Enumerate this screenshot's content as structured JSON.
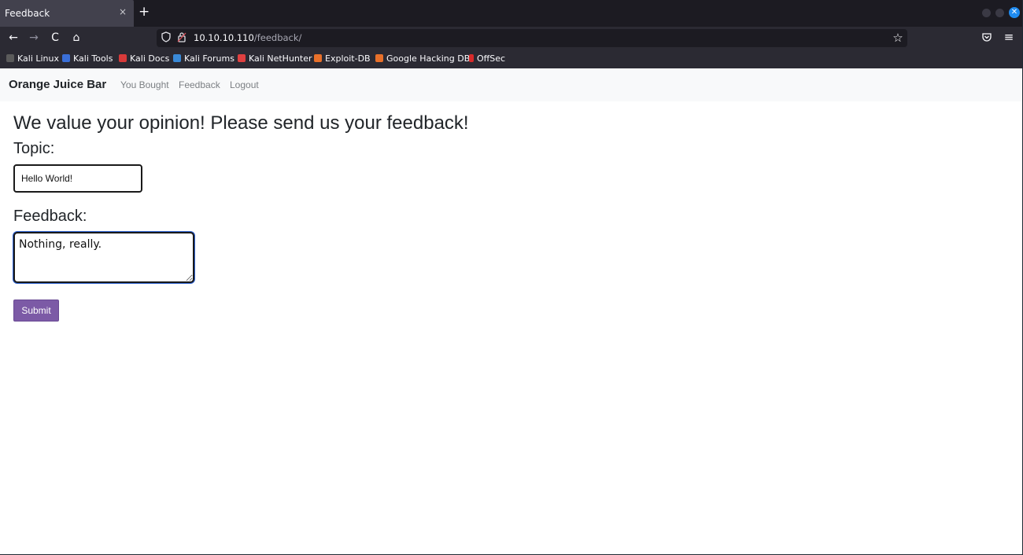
{
  "browser": {
    "tab": {
      "title": "Feedback",
      "close": "×"
    },
    "new_tab": "+",
    "nav": {
      "back": "←",
      "forward": "→",
      "reload": "C",
      "home": "⌂"
    },
    "url": {
      "host": "10.10.10.110",
      "path": "/feedback/"
    },
    "bookmark_star": "☆",
    "menu": "≡",
    "window_close": "✕",
    "bookmarks": [
      {
        "label": "Kali Linux",
        "icon": "kali-linux-icon",
        "color": "#5b5b5b"
      },
      {
        "label": "Kali Tools",
        "icon": "kali-tools-icon",
        "color": "#3a6fd8"
      },
      {
        "label": "Kali Docs",
        "icon": "kali-docs-icon",
        "color": "#d83a3a"
      },
      {
        "label": "Kali Forums",
        "icon": "kali-forums-icon",
        "color": "#3a8ad8"
      },
      {
        "label": "Kali NetHunter",
        "icon": "kali-nethunter-icon",
        "color": "#e04040"
      },
      {
        "label": "Exploit-DB",
        "icon": "exploit-db-icon",
        "color": "#e8702a"
      },
      {
        "label": "Google Hacking DB",
        "icon": "google-hacking-db-icon",
        "color": "#e8702a"
      },
      {
        "label": "OffSec",
        "icon": "offsec-icon",
        "color": "#d82a2a"
      }
    ]
  },
  "site": {
    "brand": "Orange Juice Bar",
    "nav_links": [
      "You Bought",
      "Feedback",
      "Logout"
    ]
  },
  "form": {
    "heading": "We value your opinion! Please send us your feedback!",
    "topic_label": "Topic:",
    "topic_value": "Hello World!",
    "feedback_label": "Feedback:",
    "feedback_value": "Nothing, really.",
    "submit_label": "Submit"
  },
  "colors": {
    "accent_submit": "#7c5aa6",
    "focus_ring": "#2a5fcf",
    "browser_chrome": "#2b2a33"
  }
}
